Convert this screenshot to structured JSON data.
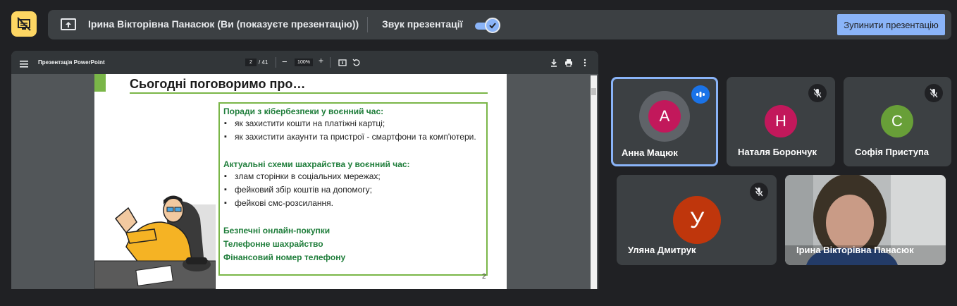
{
  "topbar": {
    "share_title": "Ірина Вікторівна Панасюк (Ви (показуєте презентацію))",
    "sound_label": "Звук презентації",
    "sound_enabled": true,
    "stop_label": "Зупинити презентацію"
  },
  "presentation": {
    "doc_title": "Презентація PowerPoint",
    "page_current": "2",
    "page_total": "/ 41",
    "zoom": "100%",
    "slide": {
      "heading": "Сьогодні поговоримо про…",
      "section1_title": "Поради з кібербезпеки у воєнний час:",
      "section1_items": [
        "як захистити кошти на платіжні картці;",
        "як захистити акаунти та пристрої - смартфони та комп'ютери."
      ],
      "section2_title": "Актуальні схеми шахрайства у воєнний час:",
      "section2_items": [
        "злам сторінки в соціальних мережах;",
        "фейковий збір коштів на допомогу;",
        "фейкові смс-розсилання."
      ],
      "links": [
        "Безпечні онлайн-покупки",
        "Телефонне шахрайство",
        "Фінансовий номер телефону"
      ],
      "page_number": "2"
    }
  },
  "participants": [
    {
      "name": "Анна Мацюк",
      "initial": "А",
      "color": "#c2185b",
      "state": "speaking"
    },
    {
      "name": "Наталя Борончук",
      "initial": "Н",
      "color": "#c2185b",
      "state": "muted"
    },
    {
      "name": "Софія Приступа",
      "initial": "С",
      "color": "#689f38",
      "state": "muted"
    },
    {
      "name": "Уляна Дмитрук",
      "initial": "У",
      "color": "#bf360c",
      "state": "muted"
    },
    {
      "name": "Ірина Вікторівна Панасюк",
      "initial": "",
      "color": "",
      "state": "camera"
    }
  ],
  "colors": {
    "accent": "#8ab4f8",
    "slide_green": "#7ab648",
    "slide_text_green": "#1e7d3a"
  }
}
